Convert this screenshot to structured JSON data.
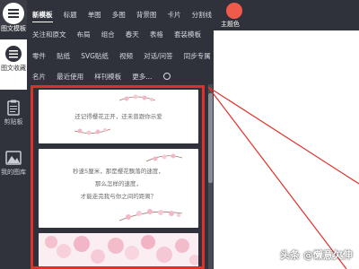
{
  "sidebar": {
    "logo_label": "图文模板",
    "items": [
      {
        "label": "图文收藏",
        "icon": "menu-list-icon"
      },
      {
        "label": "剪贴板",
        "icon": "clipboard-icon"
      },
      {
        "label": "我的图库",
        "icon": "image-library-icon"
      }
    ]
  },
  "topbar": {
    "row1": [
      "新模板",
      "标题",
      "单图",
      "多图",
      "背景图",
      "卡片",
      "分割线"
    ],
    "row2": [
      "关注和原文",
      "布局",
      "组合",
      "春天",
      "表格",
      "套装模板"
    ],
    "row3": [
      "零件",
      "贴纸",
      "SVG贴纸",
      "视频",
      "对话/问答",
      "同步专属"
    ],
    "row4": [
      "名片",
      "最近使用",
      "样刊模板",
      "更多..."
    ],
    "active": "新模板"
  },
  "theme": {
    "label": "主题色",
    "color": "#f05a4a"
  },
  "templates": [
    {
      "lines": [
        "还记得樱花正开，还未曾跟你示爱"
      ]
    },
    {
      "lines": [
        "秒速5厘米，那是樱花飘落的速度，",
        "那么怎样的速度，",
        "才能走完我与你之间的距离？"
      ]
    },
    {
      "lines": []
    }
  ],
  "watermark": "头条 @懒意欠伸",
  "colors": {
    "highlight": "#e0302b",
    "sidebar": "#30333b",
    "sakura": "#f3b8c8"
  }
}
